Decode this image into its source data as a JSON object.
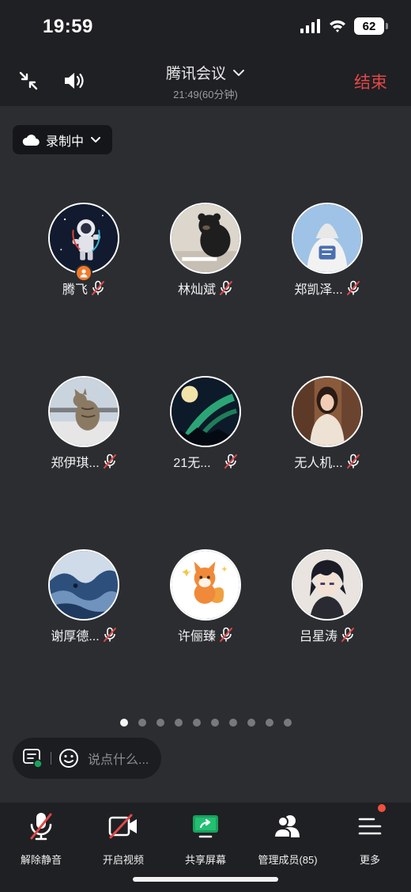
{
  "status_bar": {
    "time": "19:59",
    "battery": "62"
  },
  "header": {
    "title": "腾讯会议",
    "subtitle": "21:49(60分钟)",
    "end_label": "结束",
    "minimize_icon": "minimize-icon",
    "speaker_icon": "speaker-icon"
  },
  "recording": {
    "label": "录制中",
    "icon": "cloud-icon"
  },
  "participants": [
    {
      "name": "腾飞",
      "muted": true,
      "host": true
    },
    {
      "name": "林灿斌",
      "muted": true
    },
    {
      "name": "郑凯泽...",
      "muted": true
    },
    {
      "name": "郑伊琪...",
      "muted": true
    },
    {
      "name": "21无...",
      "muted": true
    },
    {
      "name": "无人机...",
      "muted": true
    },
    {
      "name": "谢厚德...",
      "muted": true
    },
    {
      "name": "许俪臻",
      "muted": true
    },
    {
      "name": "吕星涛",
      "muted": true
    }
  ],
  "pagination": {
    "total": 10,
    "active": 1
  },
  "chat": {
    "placeholder": "说点什么..."
  },
  "toolbar": {
    "unmute": "解除静音",
    "video": "开启视频",
    "share": "共享屏幕",
    "members": "管理成员(85)",
    "more": "更多"
  },
  "colors": {
    "accent_red": "#e04848",
    "share_green": "#19a15f",
    "host_badge": "#f07a2a"
  }
}
